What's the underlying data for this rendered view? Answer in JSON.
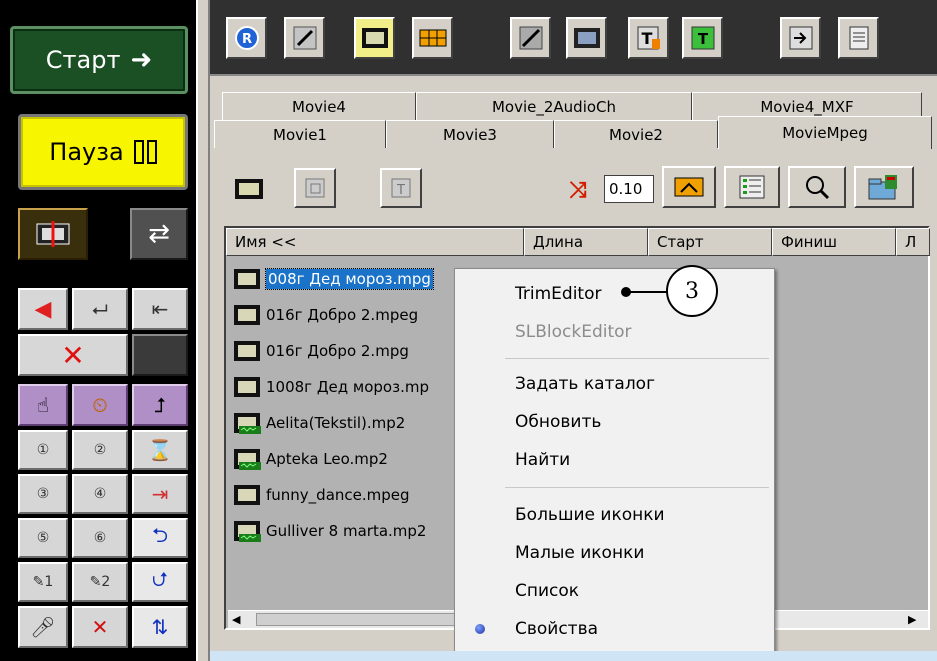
{
  "left_panel": {
    "start_label": "Старт",
    "pause_label": "Пауза"
  },
  "tabs_row1": [
    "Movie4",
    "Movie_2AudioCh",
    "Movie4_MXF"
  ],
  "tabs_row2": [
    "Movie1",
    "Movie3",
    "Movie2",
    "MovieMpeg"
  ],
  "selected_tab": "MovieMpeg",
  "shift_value": "0.10",
  "columns": [
    "Имя <<",
    "Длина",
    "Старт",
    "Финиш",
    "Л"
  ],
  "files": [
    {
      "name": "008г Дед мороз.mpg",
      "icon": "film-icon",
      "selected": true
    },
    {
      "name": "016г Добро 2.mpeg",
      "icon": "film-icon"
    },
    {
      "name": "016г Добро 2.mpg",
      "icon": "film-icon"
    },
    {
      "name": "1008г Дед мороз.mp",
      "icon": "film-icon"
    },
    {
      "name": "Aelita(Tekstil).mp2",
      "icon": "film-audio-icon"
    },
    {
      "name": "Apteka Leo.mp2",
      "icon": "film-audio-icon"
    },
    {
      "name": "funny_dance.mpeg",
      "icon": "film-icon"
    },
    {
      "name": "Gulliver 8 marta.mp2",
      "icon": "film-audio-icon"
    }
  ],
  "context_menu": {
    "group1": [
      {
        "label": "TrimEditor",
        "enabled": true
      },
      {
        "label": "SLBlockEditor",
        "enabled": false
      }
    ],
    "group2": [
      {
        "label": "Задать каталог",
        "enabled": true
      },
      {
        "label": "Обновить",
        "enabled": true
      },
      {
        "label": "Найти",
        "enabled": true
      }
    ],
    "group3": [
      {
        "label": "Большие иконки",
        "enabled": true
      },
      {
        "label": "Малые иконки",
        "enabled": true
      },
      {
        "label": "Список",
        "enabled": true
      },
      {
        "label": "Свойства",
        "enabled": true,
        "checked": true
      }
    ]
  },
  "callout_number": "3",
  "colors": {
    "start_bg": "#1b4f24",
    "pause_bg": "#f8f500",
    "selection": "#1a73c9",
    "list_bg": "#b2b2b2"
  }
}
